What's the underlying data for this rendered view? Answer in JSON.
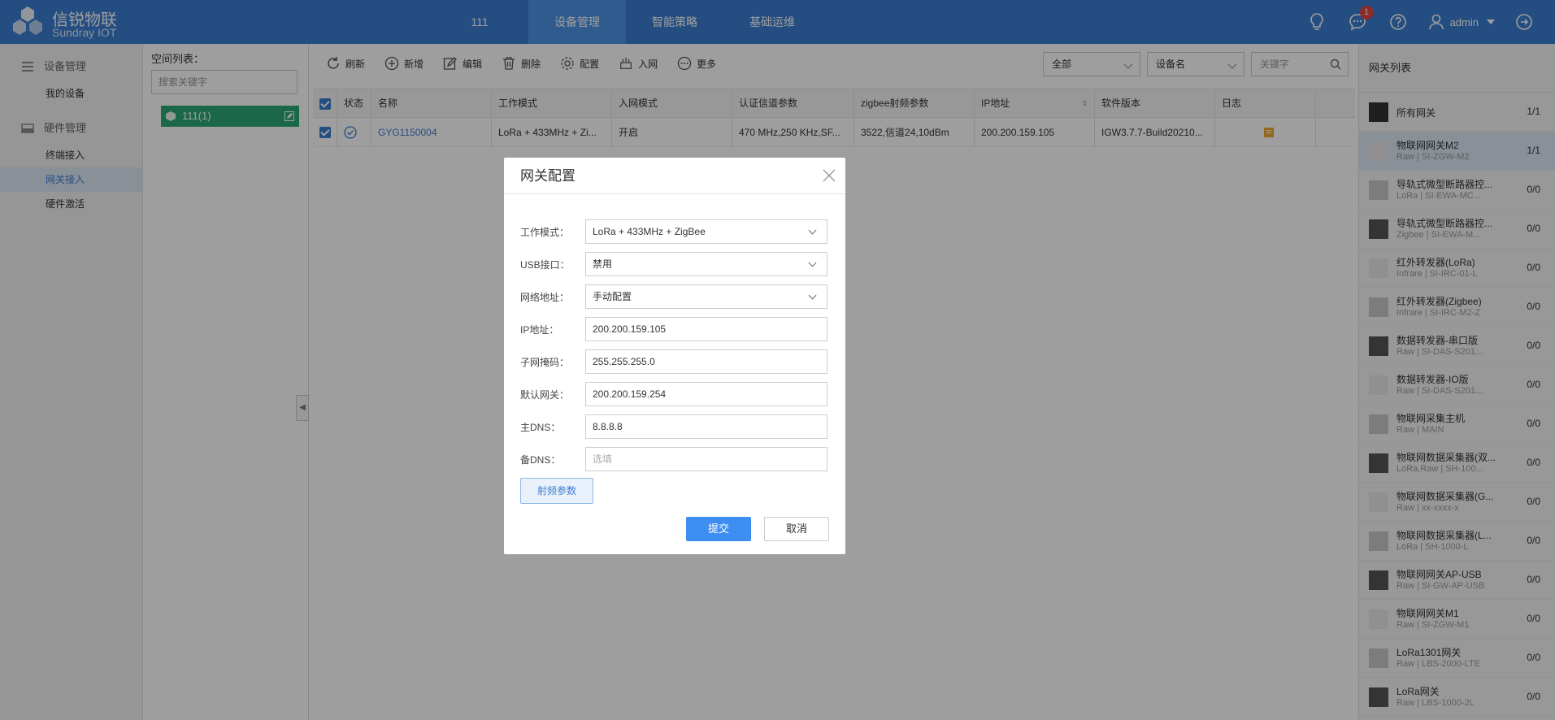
{
  "brand": {
    "name": "信锐物联",
    "name_en": "Sundray IOT"
  },
  "nav": [
    {
      "label": "111"
    },
    {
      "label": "设备管理"
    },
    {
      "label": "智能策略"
    },
    {
      "label": "基础运维"
    }
  ],
  "header": {
    "message_badge": "1",
    "username": "admin"
  },
  "sidebar": {
    "group1": "设备管理",
    "group1_items": [
      "我的设备"
    ],
    "group2": "硬件管理",
    "group2_items": [
      "终端接入",
      "网关接入",
      "硬件激活"
    ]
  },
  "space": {
    "title": "空间列表：",
    "search_placeholder": "搜索关键字",
    "node": "111(1)"
  },
  "toolbar": [
    "刷新",
    "新增",
    "编辑",
    "删除",
    "配置",
    "入网",
    "更多"
  ],
  "filters": {
    "scope": "全部",
    "field": "设备名",
    "keyword_placeholder": "关键字"
  },
  "table": {
    "columns": [
      "状态",
      "名称",
      "工作模式",
      "入网模式",
      "认证信道参数",
      "zigbee射频参数",
      "IP地址",
      "软件版本",
      "日志"
    ],
    "rows": [
      {
        "name": "GYG1150004",
        "mode": "LoRa + 433MHz + Zi...",
        "join_mode": "开启",
        "auth_channel": "470 MHz,250 KHz,SF...",
        "zigbee_rf": "3522,信道24,10dBm",
        "ip": "200.200.159.105",
        "version": "IGW3.7.7-Build20210..."
      }
    ]
  },
  "right_panel": {
    "title": "网关列表",
    "items": [
      {
        "name": "所有网关",
        "sub": "",
        "count": "1/1"
      },
      {
        "name": "物联网网关M2",
        "sub": "Raw | SI-ZGW-M2",
        "count": "1/1"
      },
      {
        "name": "导轨式微型断路器控...",
        "sub": "LoRa | SI-EWA-MC...",
        "count": "0/0"
      },
      {
        "name": "导轨式微型断路器控...",
        "sub": "Zigbee | SI-EWA-M...",
        "count": "0/0"
      },
      {
        "name": "红外转发器(LoRa)",
        "sub": "Infrare | SI-IRC-01-L",
        "count": "0/0"
      },
      {
        "name": "红外转发器(Zigbee)",
        "sub": "Infrare | SI-IRC-M2-Z",
        "count": "0/0"
      },
      {
        "name": "数据转发器-串口版",
        "sub": "Raw | SI-DAS-S201...",
        "count": "0/0"
      },
      {
        "name": "数据转发器-IO版",
        "sub": "Raw | SI-DAS-S201...",
        "count": "0/0"
      },
      {
        "name": "物联网采集主机",
        "sub": "Raw | MAIN",
        "count": "0/0"
      },
      {
        "name": "物联网数据采集器(双...",
        "sub": "LoRa,Raw | SH-100...",
        "count": "0/0"
      },
      {
        "name": "物联网数据采集器(G...",
        "sub": "Raw | xx-xxxx-x",
        "count": "0/0"
      },
      {
        "name": "物联网数据采集器(L...",
        "sub": "LoRa | SH-1000-L",
        "count": "0/0"
      },
      {
        "name": "物联网网关AP-USB",
        "sub": "Raw | SI-GW-AP-USB",
        "count": "0/0"
      },
      {
        "name": "物联网网关M1",
        "sub": "Raw | SI-ZGW-M1",
        "count": "0/0"
      },
      {
        "name": "LoRa1301网关",
        "sub": "Raw | LBS-2000-LTE",
        "count": "0/0"
      },
      {
        "name": "LoRa网关",
        "sub": "Raw | LBS-1000-2L",
        "count": "0/0"
      }
    ]
  },
  "dialog": {
    "title": "网关配置",
    "fields": [
      {
        "label": "工作模式：",
        "value": "LoRa + 433MHz + ZigBee",
        "type": "select"
      },
      {
        "label": "USB接口：",
        "value": "禁用",
        "type": "select"
      },
      {
        "label": "网络地址：",
        "value": "手动配置",
        "type": "select"
      },
      {
        "label": "IP地址：",
        "value": "200.200.159.105",
        "type": "input"
      },
      {
        "label": "子网掩码：",
        "value": "255.255.255.0",
        "type": "input"
      },
      {
        "label": "默认网关：",
        "value": "200.200.159.254",
        "type": "input"
      },
      {
        "label": "主DNS：",
        "value": "8.8.8.8",
        "type": "input"
      },
      {
        "label": "备DNS：",
        "value": "",
        "placeholder": "选填",
        "type": "input"
      }
    ],
    "rf_button": "射频参数",
    "submit": "提交",
    "cancel": "取消"
  },
  "colors": {
    "primary": "#3b7ed0",
    "active_nav": "#4d93e6",
    "space_node": "#2aa876",
    "badge": "#e54545"
  }
}
